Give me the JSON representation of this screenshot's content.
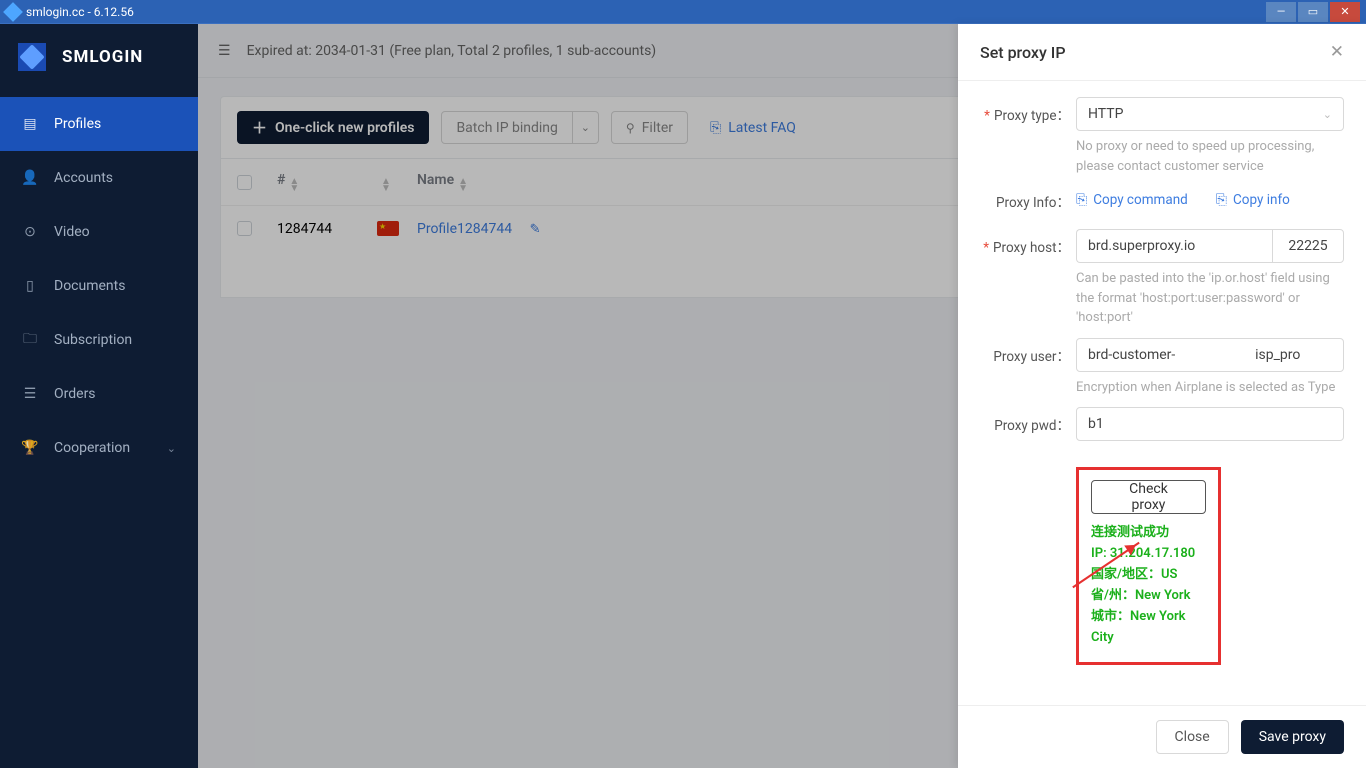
{
  "titlebar": {
    "title": "smlogin.cc - 6.12.56"
  },
  "brand": "SMLOGIN",
  "nav": {
    "profiles": "Profiles",
    "accounts": "Accounts",
    "video": "Video",
    "documents": "Documents",
    "subscription": "Subscription",
    "orders": "Orders",
    "cooperation": "Cooperation"
  },
  "expiry": "Expired at: 2034-01-31 (Free plan, Total 2 profiles, 1 sub-accounts)",
  "toolbar": {
    "new_profile": "One-click new profiles",
    "batch": "Batch IP binding",
    "filter": "Filter",
    "faq": "Latest FAQ"
  },
  "table": {
    "col_num": "#",
    "col_name": "Name",
    "rows": [
      {
        "id": "1284744",
        "name": "Profile1284744",
        "badge": "a"
      }
    ]
  },
  "drawer": {
    "title": "Set proxy IP",
    "proxy_type_label": "Proxy type：",
    "proxy_type_value": "HTTP",
    "proxy_type_hint": "No proxy or need to speed up processing, please contact customer service",
    "proxy_info_label": "Proxy Info：",
    "copy_command": "Copy command",
    "copy_info": "Copy info",
    "proxy_host_label": "Proxy host：",
    "proxy_host": "brd.superproxy.io",
    "proxy_port": "22225",
    "proxy_host_hint": "Can be pasted into the 'ip.or.host' field using the format 'host:port:user:password' or 'host:port'",
    "proxy_user_label": "Proxy user：",
    "proxy_user": "brd-customer-                       isp_pro",
    "proxy_user_hint": "Encryption when Airplane is selected as Type",
    "proxy_pwd_label": "Proxy pwd：",
    "proxy_pwd": "b1",
    "check_btn": "Check proxy",
    "result": {
      "l1": "连接测试成功",
      "l2": "IP: 31.204.17.180",
      "l3": "国家/地区：US",
      "l4": "省/州：New York",
      "l5": "城市：New York City"
    },
    "close": "Close",
    "save": "Save proxy"
  }
}
